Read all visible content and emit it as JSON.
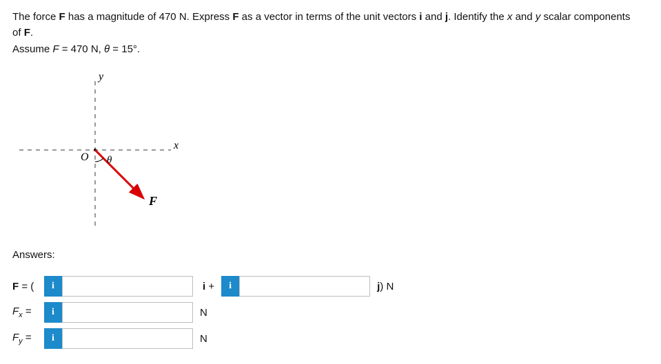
{
  "problem": {
    "line1_parts": [
      {
        "t": "The force ",
        "cls": ""
      },
      {
        "t": "F",
        "cls": "bold"
      },
      {
        "t": " has a magnitude of 470 N. Express ",
        "cls": ""
      },
      {
        "t": "F",
        "cls": "bold"
      },
      {
        "t": " as a vector in terms of the unit vectors ",
        "cls": ""
      },
      {
        "t": "i",
        "cls": "bold"
      },
      {
        "t": " and ",
        "cls": ""
      },
      {
        "t": "j",
        "cls": "bold"
      },
      {
        "t": ". Identify the ",
        "cls": ""
      },
      {
        "t": "x",
        "cls": "italic"
      },
      {
        "t": " and ",
        "cls": ""
      },
      {
        "t": "y",
        "cls": "italic"
      },
      {
        "t": " scalar components",
        "cls": ""
      }
    ],
    "line2_parts": [
      {
        "t": "of ",
        "cls": ""
      },
      {
        "t": "F",
        "cls": "bold"
      },
      {
        "t": ".",
        "cls": ""
      }
    ],
    "assume_parts": [
      {
        "t": "Assume ",
        "cls": ""
      },
      {
        "t": "F",
        "cls": "italic"
      },
      {
        "t": " = 470 N, ",
        "cls": ""
      },
      {
        "t": "θ",
        "cls": "italic"
      },
      {
        "t": " = 15°.",
        "cls": ""
      }
    ]
  },
  "diagram": {
    "y_label": "y",
    "x_label": "x",
    "origin_label": "O",
    "theta_label": "θ",
    "force_label": "F"
  },
  "answers_label": "Answers:",
  "info_char": "i",
  "inputs": {
    "F_i": "",
    "F_j": "",
    "Fx": "",
    "Fy": ""
  },
  "row_F": {
    "lhs_a": "F",
    "lhs_b": " = (",
    "mid_a": "i",
    "mid_b": " +",
    "tail_a": "j",
    "tail_b": ") N"
  },
  "row_Fx": {
    "lhs_a": "F",
    "lhs_sub": "x",
    "lhs_c": " =",
    "unit": "N"
  },
  "row_Fy": {
    "lhs_a": "F",
    "lhs_sub": "y",
    "lhs_c": " =",
    "unit": "N"
  }
}
